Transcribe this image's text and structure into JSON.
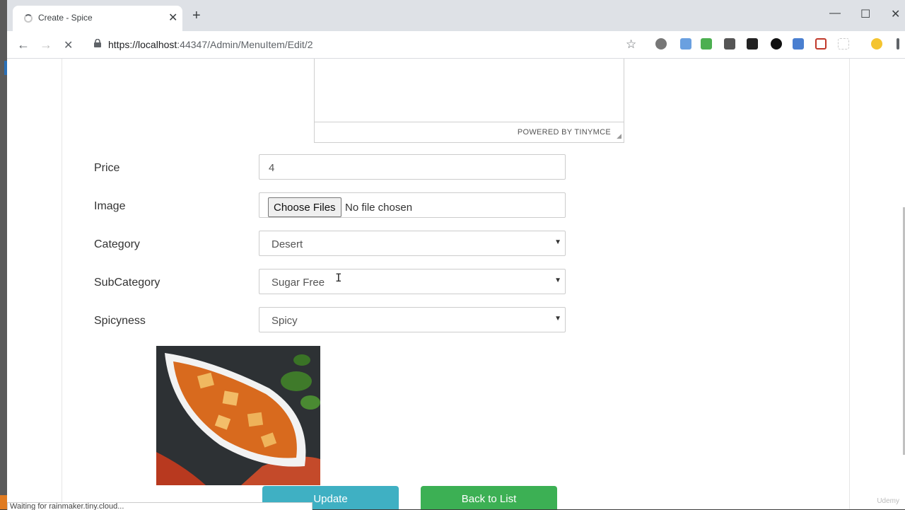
{
  "browser": {
    "tab_title": "Create - Spice",
    "tab_close": "✕",
    "new_tab": "+",
    "url_host": "https://localhost",
    "url_rest": ":44347/Admin/MenuItem/Edit/2",
    "minimize": "—",
    "maximize": "☐",
    "close": "✕",
    "back": "←",
    "forward": "→",
    "reload": "✕",
    "bookmark": "☆",
    "status_text": "Waiting for rainmaker.tiny.cloud..."
  },
  "editor": {
    "powered_by": "POWERED BY TINYMCE"
  },
  "form": {
    "price_label": "Price",
    "price_value": "4",
    "image_label": "Image",
    "choose_files": "Choose Files",
    "no_file": "No file chosen",
    "category_label": "Category",
    "category_value": "Desert",
    "subcategory_label": "SubCategory",
    "subcategory_value": "Sugar Free",
    "spicyness_label": "Spicyness",
    "spicyness_value": "Spicy",
    "update_button": "Update",
    "back_button": "Back to List"
  },
  "icons": {
    "caret": "▼"
  },
  "watermark": "Udemy"
}
